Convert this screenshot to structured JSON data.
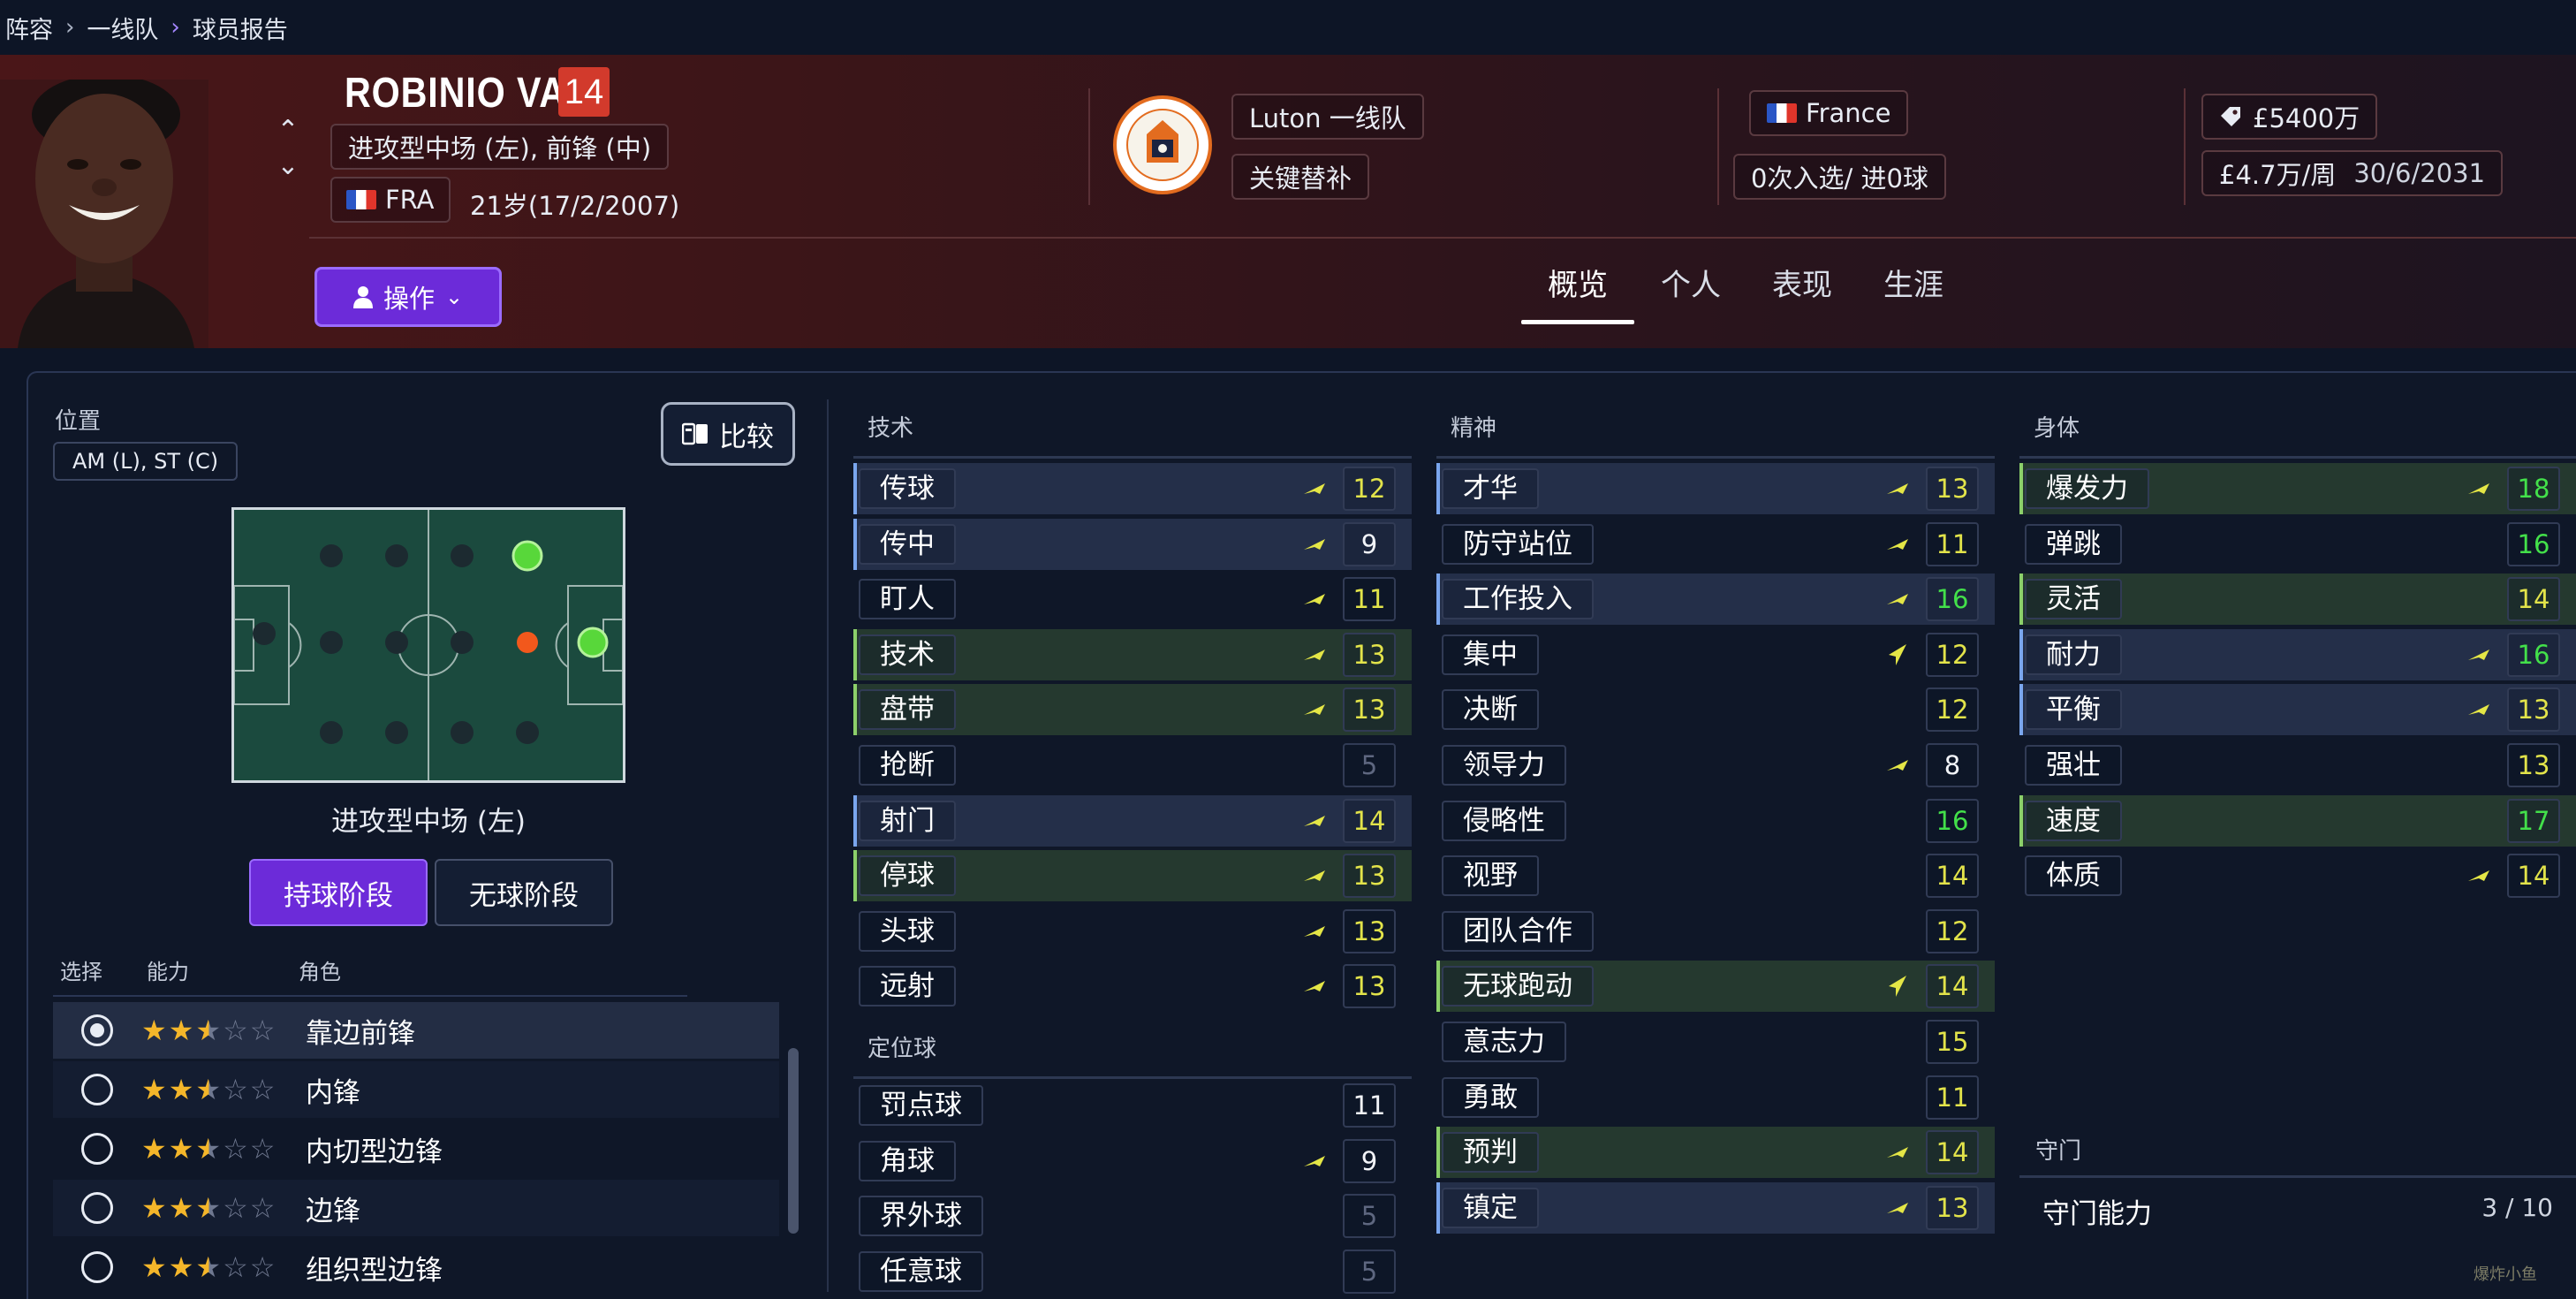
{
  "breadcrumb": {
    "items": [
      "阵容",
      "一线队",
      "球员报告"
    ]
  },
  "player": {
    "name": "ROBINIO VAZ",
    "number": "14",
    "positions": "进攻型中场 (左), 前锋 (中)",
    "nationality_code": "FRA",
    "age_birth": "21岁(17/2/2007)",
    "action_label": "操作"
  },
  "club": {
    "team": "Luton 一线队",
    "status": "关键替补"
  },
  "nation": {
    "name": "France",
    "caps": "0次入选/ 进0球"
  },
  "contract": {
    "value": "£5400万",
    "wage": "£4.7万/周",
    "expiry": "30/6/2031"
  },
  "tabs": [
    "概览",
    "个人",
    "表现",
    "生涯"
  ],
  "position_panel": {
    "label": "位置",
    "positions_short": "AM (L), ST (C)",
    "compare_label": "比较",
    "pitch_caption": "进攻型中场 (左)",
    "phase_in": "持球阶段",
    "phase_out": "无球阶段"
  },
  "roles": {
    "headers": [
      "选择",
      "能力",
      "角色"
    ],
    "items": [
      {
        "name": "靠边前锋",
        "stars": 2.5,
        "selected": true
      },
      {
        "name": "内锋",
        "stars": 2.5,
        "selected": false
      },
      {
        "name": "内切型边锋",
        "stars": 2.5,
        "selected": false
      },
      {
        "name": "边锋",
        "stars": 2.5,
        "selected": false
      },
      {
        "name": "组织型边锋",
        "stars": 2.5,
        "selected": false
      }
    ]
  },
  "attributes": {
    "technical": {
      "title": "技术",
      "items": [
        {
          "name": "传球",
          "value": "12",
          "hl": "blue",
          "arrow": "up",
          "color": "yellow"
        },
        {
          "name": "传中",
          "value": "9",
          "hl": "blue",
          "arrow": "up",
          "color": "white"
        },
        {
          "name": "盯人",
          "value": "11",
          "hl": "",
          "arrow": "up",
          "color": "yellow"
        },
        {
          "name": "技术",
          "value": "13",
          "hl": "green",
          "arrow": "up",
          "color": "yellow"
        },
        {
          "name": "盘带",
          "value": "13",
          "hl": "green",
          "arrow": "up",
          "color": "yellow"
        },
        {
          "name": "抢断",
          "value": "5",
          "hl": "",
          "arrow": "",
          "color": "grey"
        },
        {
          "name": "射门",
          "value": "14",
          "hl": "blue",
          "arrow": "up",
          "color": "yellow"
        },
        {
          "name": "停球",
          "value": "13",
          "hl": "green",
          "arrow": "up",
          "color": "yellow"
        },
        {
          "name": "头球",
          "value": "13",
          "hl": "",
          "arrow": "up",
          "color": "yellow"
        },
        {
          "name": "远射",
          "value": "13",
          "hl": "",
          "arrow": "up",
          "color": "yellow"
        }
      ]
    },
    "set_pieces": {
      "title": "定位球",
      "items": [
        {
          "name": "罚点球",
          "value": "11",
          "hl": "",
          "arrow": "",
          "color": "white"
        },
        {
          "name": "角球",
          "value": "9",
          "hl": "",
          "arrow": "up",
          "color": "white"
        },
        {
          "name": "界外球",
          "value": "5",
          "hl": "",
          "arrow": "",
          "color": "grey"
        },
        {
          "name": "任意球",
          "value": "5",
          "hl": "",
          "arrow": "",
          "color": "grey"
        }
      ]
    },
    "mental": {
      "title": "精神",
      "items": [
        {
          "name": "才华",
          "value": "13",
          "hl": "blue",
          "arrow": "up",
          "color": "yellow"
        },
        {
          "name": "防守站位",
          "value": "11",
          "hl": "",
          "arrow": "up",
          "color": "yellow"
        },
        {
          "name": "工作投入",
          "value": "16",
          "hl": "blue",
          "arrow": "up",
          "color": "green"
        },
        {
          "name": "集中",
          "value": "12",
          "hl": "",
          "arrow": "steep",
          "color": "yellow"
        },
        {
          "name": "决断",
          "value": "12",
          "hl": "",
          "arrow": "",
          "color": "yellow"
        },
        {
          "name": "领导力",
          "value": "8",
          "hl": "",
          "arrow": "up",
          "color": "white"
        },
        {
          "name": "侵略性",
          "value": "16",
          "hl": "",
          "arrow": "",
          "color": "green"
        },
        {
          "name": "视野",
          "value": "14",
          "hl": "",
          "arrow": "",
          "color": "yellow"
        },
        {
          "name": "团队合作",
          "value": "12",
          "hl": "",
          "arrow": "",
          "color": "yellow"
        },
        {
          "name": "无球跑动",
          "value": "14",
          "hl": "green",
          "arrow": "steep",
          "color": "yellow"
        },
        {
          "name": "意志力",
          "value": "15",
          "hl": "",
          "arrow": "",
          "color": "yellow"
        },
        {
          "name": "勇敢",
          "value": "11",
          "hl": "",
          "arrow": "",
          "color": "yellow"
        },
        {
          "name": "预判",
          "value": "14",
          "hl": "green",
          "arrow": "up",
          "color": "yellow"
        },
        {
          "name": "镇定",
          "value": "13",
          "hl": "blue",
          "arrow": "up",
          "color": "yellow"
        }
      ]
    },
    "physical": {
      "title": "身体",
      "items": [
        {
          "name": "爆发力",
          "value": "18",
          "hl": "green",
          "arrow": "up",
          "color": "green"
        },
        {
          "name": "弹跳",
          "value": "16",
          "hl": "",
          "arrow": "",
          "color": "green"
        },
        {
          "name": "灵活",
          "value": "14",
          "hl": "green",
          "arrow": "",
          "color": "yellow"
        },
        {
          "name": "耐力",
          "value": "16",
          "hl": "blue",
          "arrow": "up",
          "color": "green"
        },
        {
          "name": "平衡",
          "value": "13",
          "hl": "blue",
          "arrow": "up",
          "color": "yellow"
        },
        {
          "name": "强壮",
          "value": "13",
          "hl": "",
          "arrow": "",
          "color": "yellow"
        },
        {
          "name": "速度",
          "value": "17",
          "hl": "green",
          "arrow": "",
          "color": "green"
        },
        {
          "name": "体质",
          "value": "14",
          "hl": "",
          "arrow": "up",
          "color": "yellow"
        }
      ]
    },
    "goalkeeping": {
      "title": "守门",
      "label": "守门能力",
      "value": "3 / 10"
    }
  },
  "watermark": "爆炸小鱼",
  "colors": {
    "accent": "#6c2bd9",
    "yellow": "#e2e34a",
    "green": "#43e04a",
    "grey": "#5e6780",
    "white": "#f2f4f8"
  }
}
